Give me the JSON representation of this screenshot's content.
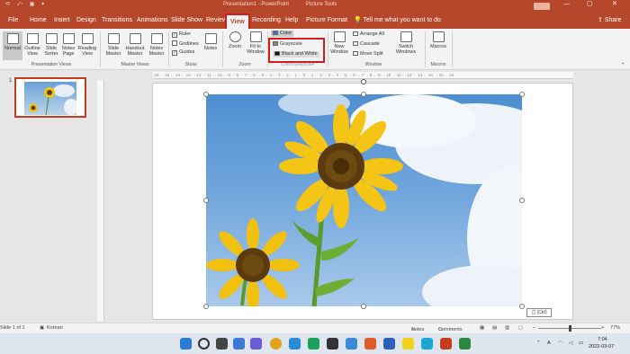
{
  "titlebar": {
    "quick_access": "⟲ ⤺ ▣ ▾",
    "document": "Presentation1 - PowerPoint",
    "context_label": "Picture Tools",
    "minimize": "—",
    "maximize": "▢",
    "close": "✕"
  },
  "tabs": [
    "File",
    "Home",
    "Insert",
    "Design",
    "Transitions",
    "Animations",
    "Slide Show",
    "Review",
    "View",
    "Recording",
    "Help",
    "Picture Format"
  ],
  "active_tab": "View",
  "tell_me": "Tell me what you want to do",
  "share": "Share",
  "ribbon": {
    "presentation_views": {
      "label": "Presentation Views",
      "buttons": [
        "Normal",
        "Outline View",
        "Slide Sorter",
        "Notes Page",
        "Reading View"
      ]
    },
    "master_views": {
      "label": "Master Views",
      "buttons": [
        "Slide Master",
        "Handout Master",
        "Notes Master"
      ]
    },
    "show": {
      "label": "Show",
      "checkboxes": [
        {
          "label": "Ruler",
          "checked": true
        },
        {
          "label": "Gridlines",
          "checked": false
        },
        {
          "label": "Guides",
          "checked": true
        }
      ],
      "notes": "Notes"
    },
    "zoom": {
      "label": "Zoom",
      "buttons": [
        "Zoom",
        "Fit to Window"
      ]
    },
    "color_grayscale": {
      "label": "Color/Grayscale",
      "items": [
        "Color",
        "Grayscale",
        "Black and White"
      ]
    },
    "window": {
      "label": "Window",
      "new_window": "New Window",
      "items": [
        "Arrange All",
        "Cascade",
        "Move Split"
      ],
      "switch": "Switch Windows"
    },
    "macros": {
      "label": "Macros",
      "button": "Macros"
    }
  },
  "thumbnail": {
    "number": "1"
  },
  "paste_options": "(Ctrl)",
  "statusbar": {
    "slide": "Slide 1 of 1",
    "language": "Korean",
    "notes": "Notes",
    "comments": "Comments",
    "zoom": "77%"
  },
  "taskbar": {
    "time": "7:04",
    "date": "2022-03-07",
    "lang": "A"
  }
}
